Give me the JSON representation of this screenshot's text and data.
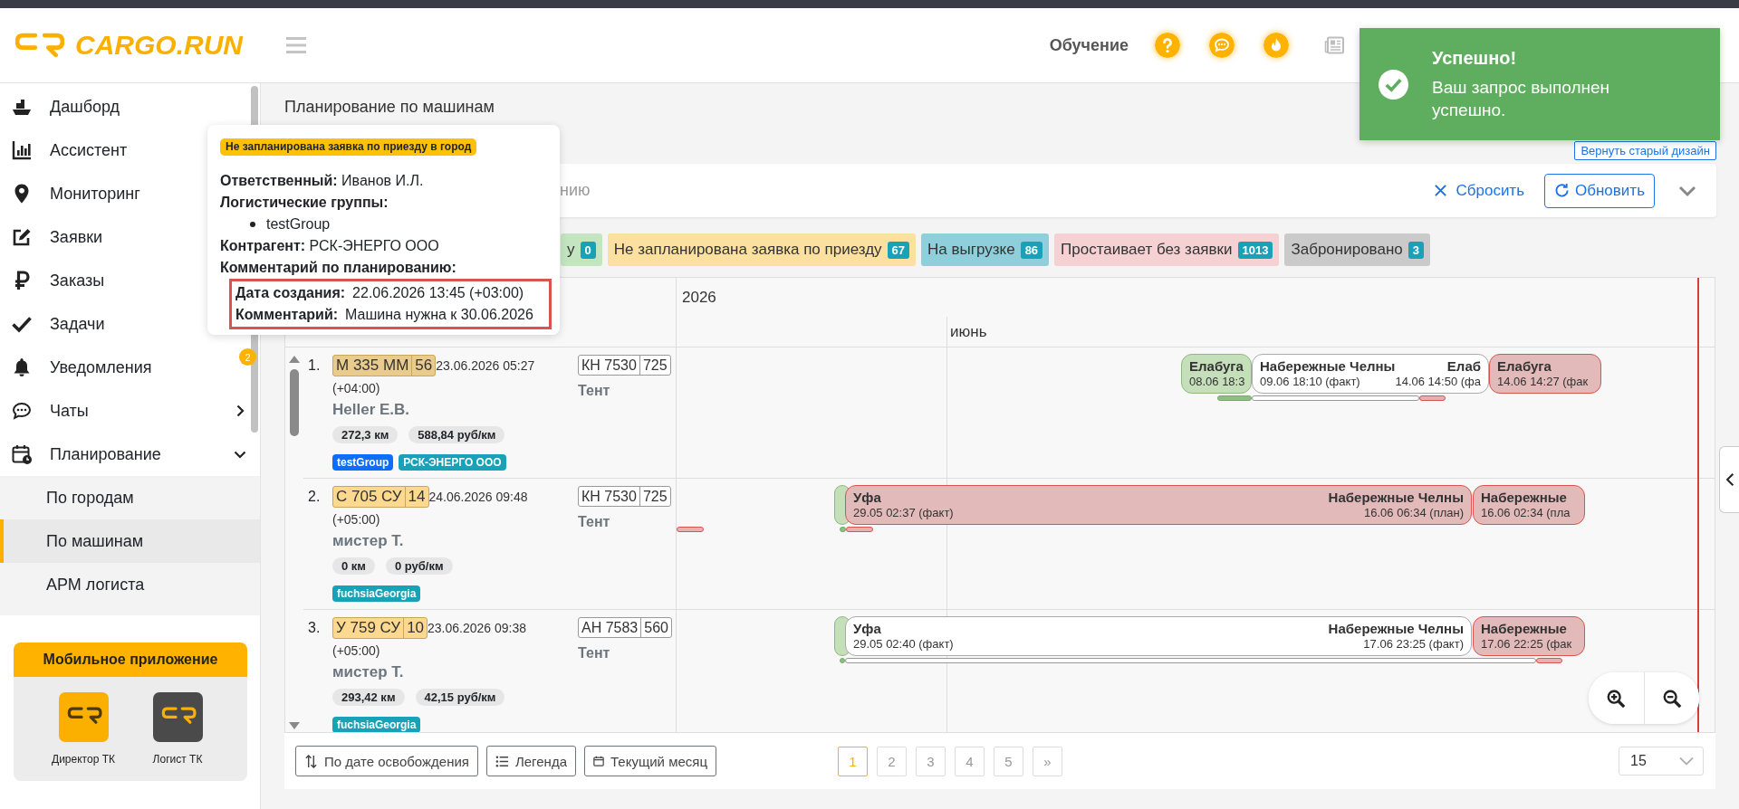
{
  "header": {
    "logo": "CARGO.RUN",
    "training_link": "Обучение"
  },
  "toast": {
    "title": "Успешно!",
    "message": "Ваш запрос выполнен успешно."
  },
  "sidebar": {
    "items": [
      {
        "label": "Дашборд",
        "kind": "link"
      },
      {
        "label": "Ассистент",
        "kind": "link"
      },
      {
        "label": "Мониторинг",
        "kind": "link"
      },
      {
        "label": "Заявки",
        "kind": "link"
      },
      {
        "label": "Заказы",
        "kind": "link"
      },
      {
        "label": "Задачи",
        "kind": "link"
      },
      {
        "label": "Уведомления",
        "kind": "link",
        "badge": "2"
      },
      {
        "label": "Чаты",
        "kind": "group",
        "expanded": false
      },
      {
        "label": "Планирование",
        "kind": "group",
        "expanded": true,
        "children": [
          {
            "label": "По городам",
            "selected": false
          },
          {
            "label": "По машинам",
            "selected": true
          },
          {
            "label": "АРМ логиста",
            "selected": false
          }
        ]
      }
    ],
    "mobile_apps": {
      "title": "Мобильное приложение",
      "apps": [
        {
          "label": "Директор ТК",
          "color": "#fbb000"
        },
        {
          "label": "Логист ТК",
          "color": "#4a4a4a"
        }
      ]
    }
  },
  "page": {
    "title": "Планирование по машинам",
    "old_design_button": "Вернуть старый дизайн"
  },
  "filter": {
    "placeholder": "нию",
    "reset_link": "Сбросить",
    "refresh_button": "Обновить"
  },
  "status_chips": [
    {
      "label": "у",
      "count": "0",
      "color": "#c3e6c1"
    },
    {
      "label": "Не запланирована заявка по приезду",
      "count": "67",
      "color": "#fce0a0"
    },
    {
      "label": "На выгрузке",
      "count": "86",
      "color": "#8fcfdc"
    },
    {
      "label": "Простаивает без заявки",
      "count": "1013",
      "color": "#f5d1d3"
    },
    {
      "label": "Забронировано",
      "count": "3",
      "color": "#cacaca"
    }
  ],
  "tooltip": {
    "badge": "Не запланирована заявка по приезду в город",
    "responsible": {
      "label": "Ответственный:",
      "value": "Иванов И.Л."
    },
    "groups": {
      "label": "Логистические группы:",
      "items": [
        "testGroup"
      ]
    },
    "counterparty": {
      "label": "Контрагент:",
      "value": "РСК-ЭНЕРГО ООО"
    },
    "comment_heading": "Комментарий по планированию:",
    "created": {
      "label": "Дата создания:",
      "value": "22.06.2026 13:45 (+03:00)"
    },
    "comment": {
      "label": "Комментарий:",
      "value": "Машина нужна к 30.06.2026"
    }
  },
  "timeline": {
    "year": "2026",
    "month": "июнь",
    "rows": [
      {
        "number": "1.",
        "plate": {
          "number": "М 335 ММ",
          "region": "56",
          "color": "#e8cb8d"
        },
        "date": "23.06.2026 05:27",
        "timezone": "(+04:00)",
        "driver": "Heller E.B.",
        "distance": "272,3 км",
        "rate": "588,84 руб/км",
        "tags": [
          {
            "label": "testGroup",
            "color": "#0d6efd"
          },
          {
            "label": "РСК-ЭНЕРГО ООО",
            "color": "#17a2b8"
          }
        ],
        "trailer": {
          "number": "КН 7530",
          "region": "725"
        },
        "body_type": "Тент",
        "segments": [
          {
            "kind": "completed",
            "start": {
              "city": "Елабуга",
              "time": "08.06 18:3"
            }
          },
          {
            "kind": "current",
            "start": {
              "city": "Набережные Челны",
              "time": "09.06 18:10 (факт)"
            },
            "end": {
              "city": "Елаб",
              "time": "14.06 14:50 (фа"
            }
          },
          {
            "kind": "overdue",
            "start": {
              "city": "Елабуга",
              "time": "14.06 14:27 (фак"
            }
          }
        ],
        "strips": [
          {
            "kind": "completed"
          },
          {
            "kind": "current"
          },
          {
            "kind": "overdue"
          }
        ]
      },
      {
        "number": "2.",
        "plate": {
          "number": "С 705 СУ",
          "region": "14",
          "color": "#fcd98e"
        },
        "date": "24.06.2026 09:48",
        "timezone": "(+05:00)",
        "driver": "мистер Т.",
        "distance": "0 км",
        "rate": "0 руб/км",
        "tags": [
          {
            "label": "fuchsiaGeorgia",
            "color": "#17a2b8"
          }
        ],
        "trailer": {
          "number": "КН 7530",
          "region": "725"
        },
        "body_type": "Тент",
        "segments": [
          {
            "kind": "completed"
          },
          {
            "kind": "overdue",
            "start": {
              "city": "Уфа",
              "time": "29.05 02:37 (факт)"
            },
            "end": {
              "city": "Набережные Челны",
              "time": "16.06 06:34 (план)"
            }
          },
          {
            "kind": "overdue",
            "start": {
              "city": "Набережные",
              "time": "16.06 02:34 (пла"
            }
          }
        ],
        "strips": [
          {
            "kind": "overdue"
          },
          {
            "kind": "completed"
          },
          {
            "kind": "overdue"
          }
        ]
      },
      {
        "number": "3.",
        "plate": {
          "number": "У 759 СУ",
          "region": "10",
          "color": "#fcd98e"
        },
        "date": "23.06.2026 09:38",
        "timezone": "(+05:00)",
        "driver": "мистер Т.",
        "distance": "293,42 км",
        "rate": "42,15 руб/км",
        "tags": [
          {
            "label": "fuchsiaGeorgia",
            "color": "#17a2b8"
          }
        ],
        "trailer": {
          "number": "АН 7583",
          "region": "560"
        },
        "body_type": "Тент",
        "segments": [
          {
            "kind": "completed"
          },
          {
            "kind": "current",
            "start": {
              "city": "Уфа",
              "time": "29.05 02:40 (факт)"
            },
            "end": {
              "city": "Набережные Челны",
              "time": "17.06 23:25 (факт)"
            }
          },
          {
            "kind": "overdue",
            "start": {
              "city": "Набережные",
              "time": "17.06 22:25 (фак"
            }
          }
        ],
        "strips": [
          {
            "kind": "completed"
          },
          {
            "kind": "current"
          },
          {
            "kind": "overdue"
          }
        ]
      }
    ]
  },
  "bottom_bar": {
    "sort_button": "По дате освобождения",
    "legend_button": "Легенда",
    "month_button": "Текущий месяц",
    "pages": [
      {
        "label": "1",
        "selected": true
      },
      {
        "label": "2",
        "selected": false
      },
      {
        "label": "3",
        "selected": false
      },
      {
        "label": "4",
        "selected": false
      },
      {
        "label": "5",
        "selected": false
      },
      {
        "label": "»",
        "selected": false
      }
    ],
    "page_size": "15"
  }
}
